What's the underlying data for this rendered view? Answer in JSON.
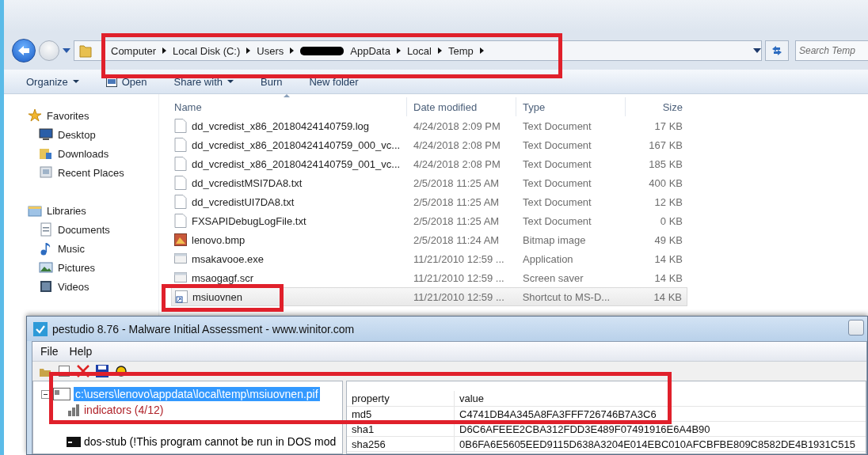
{
  "explorer": {
    "breadcrumbs": [
      {
        "kind": "text",
        "label": "Computer"
      },
      {
        "kind": "text",
        "label": "Local Disk (C:)"
      },
      {
        "kind": "text",
        "label": "Users"
      },
      {
        "kind": "redacted"
      },
      {
        "kind": "text",
        "label": "AppData"
      },
      {
        "kind": "text",
        "label": "Local"
      },
      {
        "kind": "text",
        "label": "Temp"
      }
    ],
    "search": {
      "placeholder": "Search Temp"
    },
    "toolbar": [
      {
        "kind": "dropdown",
        "label": "Organize"
      },
      {
        "kind": "icon",
        "label": "Open"
      },
      {
        "kind": "dropdown",
        "label": "Share with"
      },
      {
        "kind": "plain",
        "label": "Burn"
      },
      {
        "kind": "plain",
        "label": "New folder"
      }
    ],
    "sidebar": [
      {
        "label": "Favorites",
        "children": [
          {
            "label": "Desktop"
          },
          {
            "label": "Downloads"
          },
          {
            "label": "Recent Places"
          }
        ]
      },
      {
        "label": "Libraries",
        "children": [
          {
            "label": "Documents"
          },
          {
            "label": "Music"
          },
          {
            "label": "Pictures"
          },
          {
            "label": "Videos"
          }
        ]
      }
    ],
    "columns": [
      "Name",
      "Date modified",
      "Type",
      "Size"
    ],
    "files": [
      {
        "kind": "text",
        "name": "dd_vcredist_x86_20180424140759.log",
        "date": "4/24/2018 2:09 PM",
        "type": "Text Document",
        "size": "17 KB",
        "selected": false
      },
      {
        "kind": "text",
        "name": "dd_vcredist_x86_20180424140759_000_vc...",
        "date": "4/24/2018 2:08 PM",
        "type": "Text Document",
        "size": "167 KB",
        "selected": false
      },
      {
        "kind": "text",
        "name": "dd_vcredist_x86_20180424140759_001_vc...",
        "date": "4/24/2018 2:08 PM",
        "type": "Text Document",
        "size": "185 KB",
        "selected": false
      },
      {
        "kind": "text",
        "name": "dd_vcredistMSI7DA8.txt",
        "date": "2/5/2018 11:25 AM",
        "type": "Text Document",
        "size": "400 KB",
        "selected": false
      },
      {
        "kind": "text",
        "name": "dd_vcredistUI7DA8.txt",
        "date": "2/5/2018 11:25 AM",
        "type": "Text Document",
        "size": "12 KB",
        "selected": false
      },
      {
        "kind": "text",
        "name": "FXSAPIDebugLogFile.txt",
        "date": "2/5/2018 11:25 AM",
        "type": "Text Document",
        "size": "0 KB",
        "selected": false
      },
      {
        "kind": "image",
        "name": "lenovo.bmp",
        "date": "2/5/2018 11:24 AM",
        "type": "Bitmap image",
        "size": "49 KB",
        "selected": false
      },
      {
        "kind": "app",
        "name": "msakavooe.exe",
        "date": "11/21/2010 12:59 ...",
        "type": "Application",
        "size": "14 KB",
        "selected": false
      },
      {
        "kind": "app",
        "name": "msaogagf.scr",
        "date": "11/21/2010 12:59 ...",
        "type": "Screen saver",
        "size": "14 KB",
        "selected": false
      },
      {
        "kind": "shortcut",
        "name": "msiuovnen",
        "date": "11/21/2010 12:59 ...",
        "type": "Shortcut to MS-D...",
        "size": "14 KB",
        "selected": true
      }
    ]
  },
  "pestudio": {
    "title": "pestudio 8.76 - Malware Initial Assessment - www.winitor.com",
    "menu": [
      "File",
      "Help"
    ],
    "tree": {
      "label": "c:\\users\\lenovo\\appdata\\local\\temp\\msiuovnen.pif",
      "selected": true,
      "expanded": true,
      "children": [
        {
          "label": "indicators (4/12)",
          "color": "#b0232a"
        },
        {
          "label": "dos-stub (!This program cannot be run in DOS mod",
          "color": "#000000"
        }
      ]
    },
    "columns": [
      "property",
      "value"
    ],
    "rows": [
      {
        "property": "md5",
        "value": "C4741DB4A345A8FA3FFF726746B7A3C6"
      },
      {
        "property": "sha1",
        "value": "D6C6AFEEE2CBA312FDD3E489F07491916E6A4B90"
      },
      {
        "property": "sha256",
        "value": "0B6FA6E5605EED9115D638A3204E014EBC010AFCBFBE809C8582DE4B1931C515"
      }
    ]
  }
}
